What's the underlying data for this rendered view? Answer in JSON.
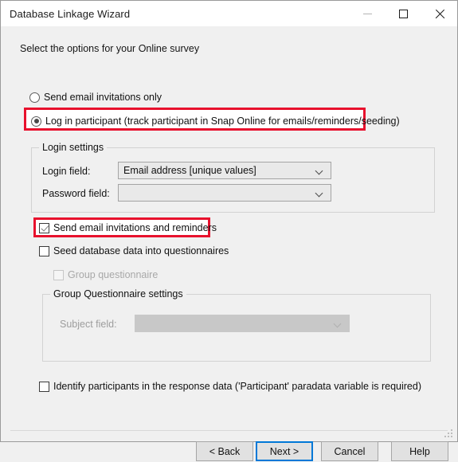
{
  "window": {
    "title": "Database Linkage Wizard",
    "controls": {
      "minimize": "minimize-icon",
      "maximize": "maximize-icon",
      "close": "close-icon"
    }
  },
  "main": {
    "intro": "Select the options for your Online survey",
    "radios": [
      {
        "label": "Send email invitations only",
        "checked": false,
        "highlighted": false
      },
      {
        "label": "Log in participant (track participant in Snap Online for emails/reminders/seeding)",
        "checked": true,
        "highlighted": true
      }
    ],
    "login_settings": {
      "title": "Login settings",
      "login_field": {
        "label": "Login field:",
        "value": "Email address [unique values]",
        "disabled": false
      },
      "password_field": {
        "label": "Password field:",
        "value": "",
        "disabled": false
      }
    },
    "checkboxes": [
      {
        "label": "Send email invitations and reminders",
        "checked": true,
        "disabled": false,
        "highlighted": true
      },
      {
        "label": "Seed database data into questionnaires",
        "checked": false,
        "disabled": false,
        "highlighted": false
      },
      {
        "label": "Group questionnaire",
        "checked": false,
        "disabled": true,
        "highlighted": false
      }
    ],
    "group_questionnaire_settings": {
      "title": "Group Questionnaire settings",
      "subject_field": {
        "label": "Subject field:",
        "value": "",
        "disabled": true
      }
    },
    "identify_checkbox": {
      "label": "Identify participants in the response data ('Participant' paradata variable is required)",
      "checked": false
    }
  },
  "footer": {
    "back": "< Back",
    "next": "Next >",
    "cancel": "Cancel",
    "help": "Help"
  },
  "colors": {
    "highlight": "#e8112d",
    "default_button_focus": "#0078d7",
    "dialog_background": "#f0f0f0",
    "titlebar_background": "#ffffff"
  }
}
